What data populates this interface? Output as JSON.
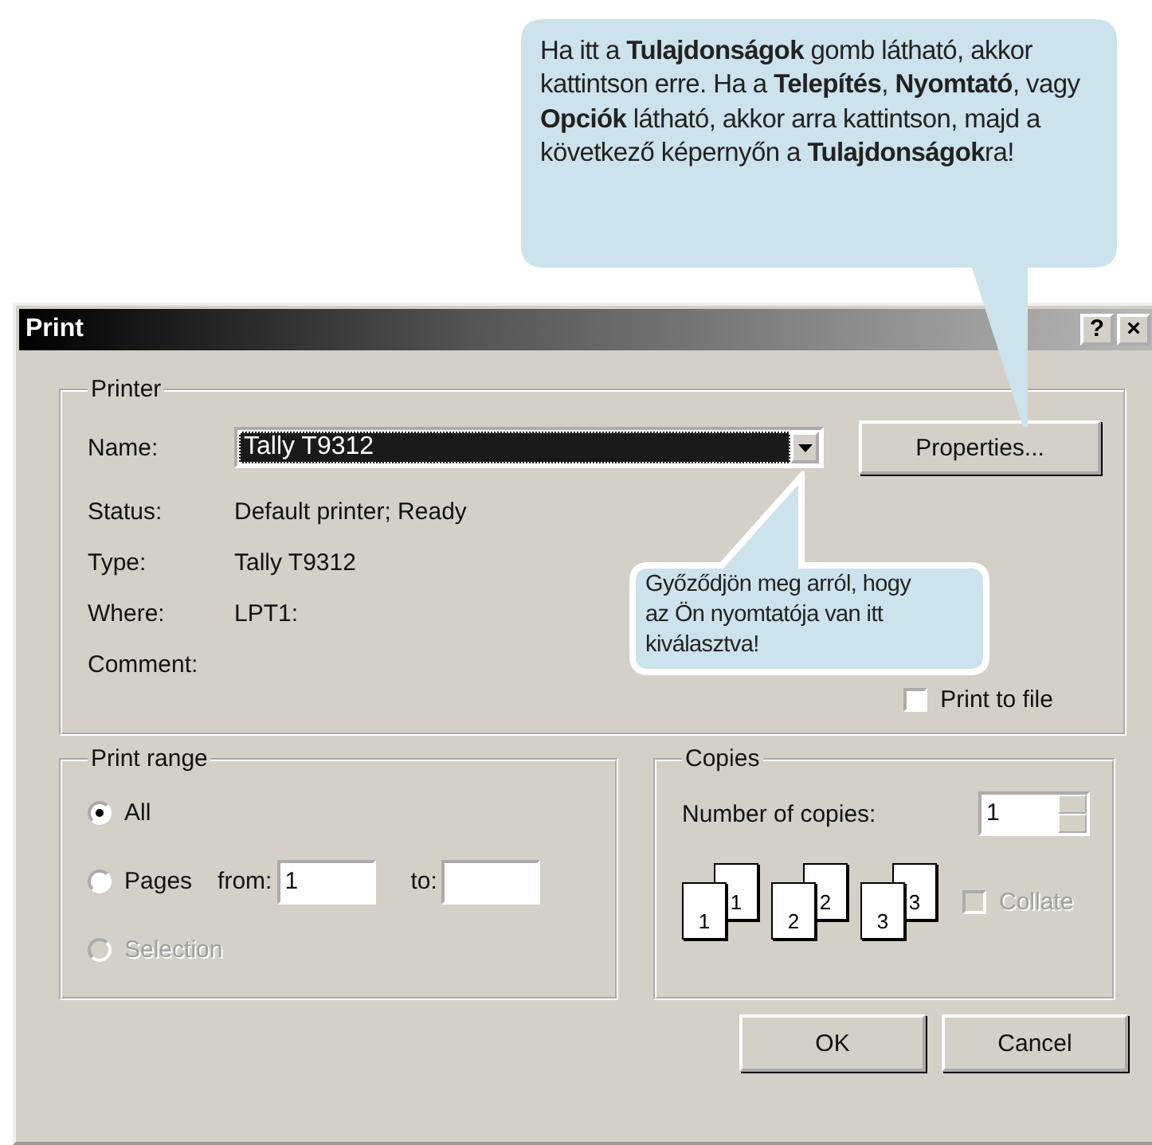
{
  "top_callout": {
    "text": "Ha itt a **Tulajdonságok** gomb látható, akkor kattintson erre. Ha a **Telepítés**, **Nyomtató**, vagy **Opciók** látható, akkor arra kattintson, majd a következő képernyőn a **Tulajdonságok**ra!"
  },
  "dialog": {
    "title": "Print",
    "title_buttons": [
      "?",
      "×"
    ]
  },
  "printer": {
    "legend": "Printer",
    "name_label": "Name:",
    "name_value": "Tally T9312",
    "properties_button": "Properties...",
    "fields": [
      {
        "label": "Status:",
        "value": "Default printer; Ready"
      },
      {
        "label": "Type:",
        "value": "Tally T9312"
      },
      {
        "label": "Where:",
        "value": "LPT1:"
      },
      {
        "label": "Comment:"
      }
    ],
    "print_to_file": {
      "label": "Print to file",
      "checked": false
    }
  },
  "print_range": {
    "legend": "Print range",
    "options": [
      {
        "kind": "plain",
        "label": "All",
        "selected": true,
        "disabled": false
      },
      {
        "kind": "pages",
        "label": "Pages",
        "selected": false,
        "disabled": false
      },
      {
        "kind": "plain",
        "label": "Selection",
        "selected": false,
        "disabled": true
      }
    ],
    "from_label": "from:",
    "from_value": "1",
    "to_label": "to:"
  },
  "copies": {
    "legend": "Copies",
    "count_label": "Number of copies:",
    "count_value": "1",
    "collate_stacks": [
      {
        "front": "1",
        "back": "1"
      },
      {
        "front": "2",
        "back": "2"
      },
      {
        "front": "3",
        "back": "3"
      }
    ],
    "collate": {
      "label": "Collate",
      "checked": false,
      "disabled": true
    }
  },
  "buttons": [
    "OK",
    "Cancel"
  ],
  "bottom_callout": {
    "text": "Győződjön meg arról, hogy az Ön nyomtatója van itt kiválasztva!"
  }
}
